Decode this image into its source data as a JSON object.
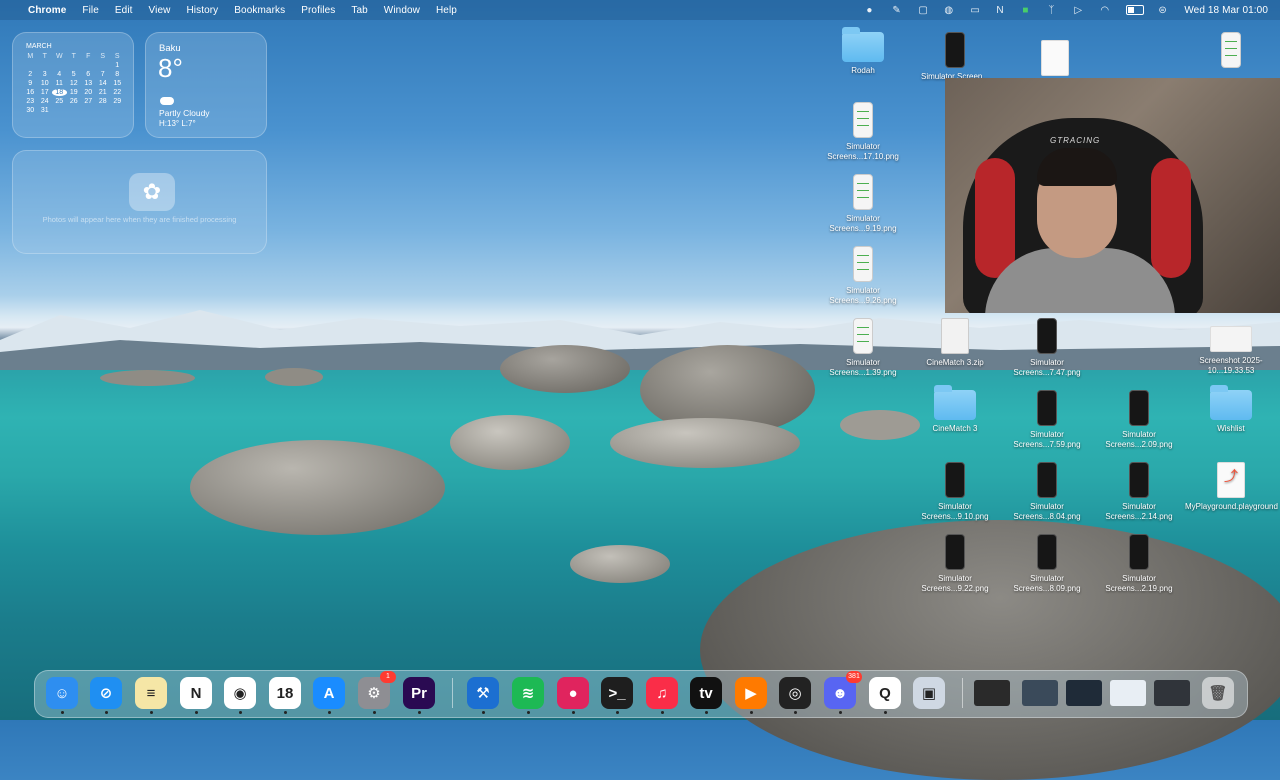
{
  "menubar": {
    "app_name": "Chrome",
    "menus": [
      "File",
      "Edit",
      "View",
      "History",
      "Bookmarks",
      "Profiles",
      "Tab",
      "Window",
      "Help"
    ],
    "clock": "Wed 18 Mar  01:00",
    "status_icons": [
      "record-icon",
      "pen-icon",
      "screen-icon",
      "vpn-icon",
      "display-icon",
      "n-icon",
      "camera-icon",
      "antenna-icon",
      "play-icon",
      "wifi-icon",
      "battery-icon",
      "control-center-icon"
    ]
  },
  "calendar": {
    "month": "MARCH",
    "weekdays": [
      "M",
      "T",
      "W",
      "T",
      "F",
      "S",
      "S"
    ],
    "weeks": [
      [
        "",
        "",
        "",
        "",
        "",
        "",
        "1"
      ],
      [
        "2",
        "3",
        "4",
        "5",
        "6",
        "7",
        "8"
      ],
      [
        "9",
        "10",
        "11",
        "12",
        "13",
        "14",
        "15"
      ],
      [
        "16",
        "17",
        "18",
        "19",
        "20",
        "21",
        "22"
      ],
      [
        "23",
        "24",
        "25",
        "26",
        "27",
        "28",
        "29"
      ],
      [
        "30",
        "31",
        "",
        "",
        "",
        "",
        ""
      ]
    ],
    "today": "18"
  },
  "weather": {
    "city": "Baku",
    "temp": "8°",
    "condition": "Partly Cloudy",
    "high_low": "H:13° L:7°"
  },
  "photos_widget": {
    "message": "Photos will appear here when they are finished processing"
  },
  "desktop_icons": [
    {
      "label": "Rodah",
      "kind": "folder"
    },
    {
      "label": "Simulator Screen...",
      "kind": "phone-dark"
    },
    {
      "label": "",
      "kind": "doc"
    },
    {
      "label": "",
      "kind": "phone-light"
    },
    {
      "label": "Simulator Screens...17.10.png",
      "kind": "phone-light"
    },
    {
      "label": "Simulator Screens...9.19.png",
      "kind": "phone-light"
    },
    {
      "label": "Simulator Screens...9.26.png",
      "kind": "phone-light"
    },
    {
      "label": "Simulator Screens...1.39.png",
      "kind": "phone-light"
    },
    {
      "label": "CineMatch 3.zip",
      "kind": "zip"
    },
    {
      "label": "Simulator Screens...7.47.png",
      "kind": "phone-dark"
    },
    {
      "label": "Screenshot 2025-10...19.33.53",
      "kind": "shot"
    },
    {
      "label": "CineMatch 3",
      "kind": "folder"
    },
    {
      "label": "Simulator Screens...7.59.png",
      "kind": "phone-dark"
    },
    {
      "label": "Simulator Screens...2.09.png",
      "kind": "phone-dark"
    },
    {
      "label": "Wishlist",
      "kind": "folder"
    },
    {
      "label": "Simulator Screens...9.10.png",
      "kind": "phone-dark"
    },
    {
      "label": "Simulator Screens...8.04.png",
      "kind": "phone-dark"
    },
    {
      "label": "Simulator Screens...2.14.png",
      "kind": "phone-dark"
    },
    {
      "label": "MyPlayground.playground",
      "kind": "swift"
    },
    {
      "label": "Simulator Screens...9.22.png",
      "kind": "phone-dark"
    },
    {
      "label": "Simulator Screens...8.09.png",
      "kind": "phone-dark"
    },
    {
      "label": "Simulator Screens...2.19.png",
      "kind": "phone-dark"
    }
  ],
  "webcam": {
    "chair_brand": "GTRACING"
  },
  "dock": {
    "apps": [
      {
        "name": "finder-icon",
        "glyph": "☺",
        "bg": "#2e8ef0"
      },
      {
        "name": "safari-icon",
        "glyph": "⊘",
        "bg": "#1f8ff2"
      },
      {
        "name": "notes-icon",
        "glyph": "≡",
        "bg": "#f5e6a6"
      },
      {
        "name": "notion-icon",
        "glyph": "N",
        "bg": "#ffffff"
      },
      {
        "name": "chrome-icon",
        "glyph": "◉",
        "bg": "#ffffff"
      },
      {
        "name": "calendar-icon",
        "glyph": "18",
        "bg": "#ffffff"
      },
      {
        "name": "app-store-icon",
        "glyph": "A",
        "bg": "#1a8cff"
      },
      {
        "name": "system-settings-icon",
        "glyph": "⚙",
        "bg": "#8e8e93",
        "badge": "1"
      },
      {
        "name": "premiere-icon",
        "glyph": "Pr",
        "bg": "#2a0a52"
      },
      {
        "name": "xcode-icon",
        "glyph": "⚒",
        "bg": "#1c6fd1"
      },
      {
        "name": "spotify-icon",
        "glyph": "≋",
        "bg": "#1db954"
      },
      {
        "name": "screen-recorder-icon",
        "glyph": "●",
        "bg": "#e0245e"
      },
      {
        "name": "terminal-icon",
        "glyph": ">_",
        "bg": "#1e1e1e"
      },
      {
        "name": "music-icon",
        "glyph": "♫",
        "bg": "#fa2d48"
      },
      {
        "name": "apple-tv-icon",
        "glyph": "tv",
        "bg": "#111111"
      },
      {
        "name": "infuse-icon",
        "glyph": "▶",
        "bg": "#ff7a00"
      },
      {
        "name": "obs-icon",
        "glyph": "◎",
        "bg": "#222222"
      },
      {
        "name": "discord-icon",
        "glyph": "☻",
        "bg": "#5865f2",
        "badge": "381"
      },
      {
        "name": "proxyman-icon",
        "glyph": "Q",
        "bg": "#ffffff"
      },
      {
        "name": "simulator-icon",
        "glyph": "▣",
        "bg": "#cfd8e3"
      }
    ],
    "trash_name": "trash-icon"
  }
}
